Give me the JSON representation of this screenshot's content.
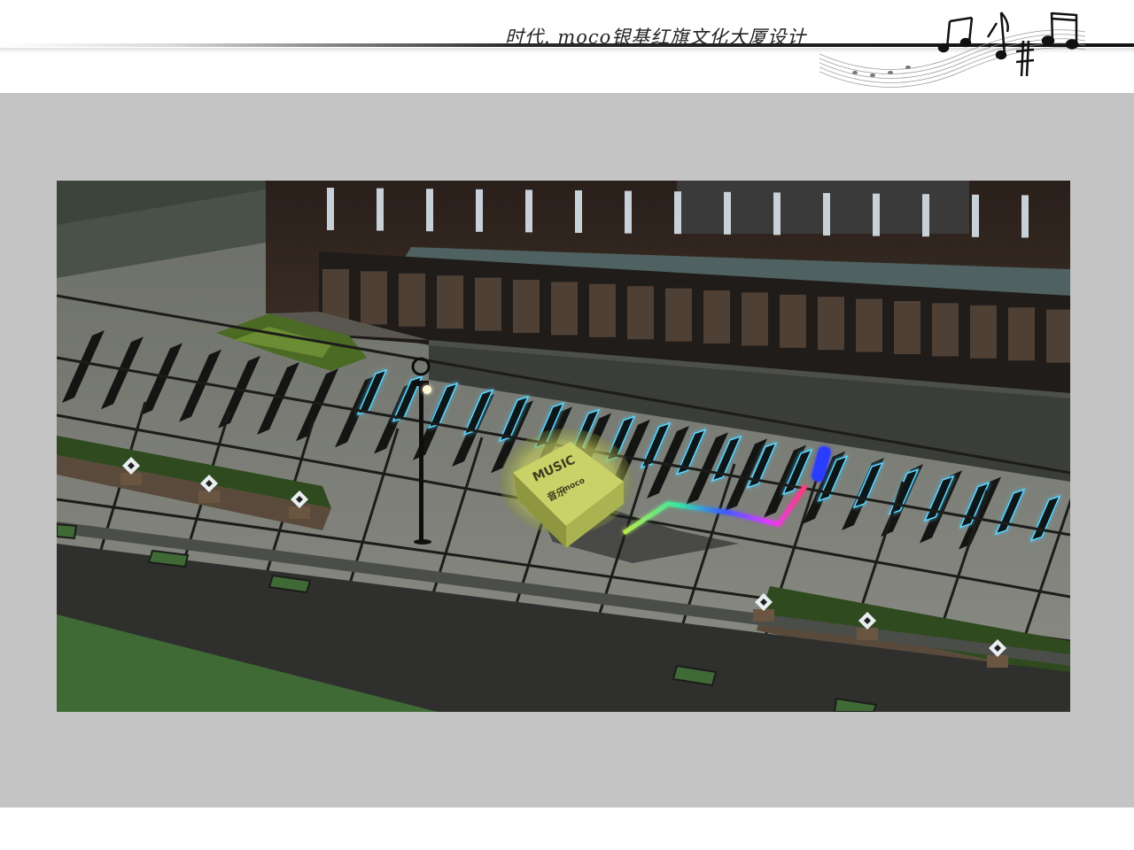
{
  "header": {
    "title": "时代. moco银基红旗文化大厦设计",
    "decoration_icon": "music-notes-icon"
  },
  "colors": {
    "page_background": "#ffffff",
    "panel_background": "#c4c4c4",
    "building_facade": "#2e241f",
    "plaza_paving": "#7d7f78",
    "key_glow": "#5fd6ff",
    "cube_glow": "#dfe87a",
    "hedge_green": "#2f4a1e"
  },
  "scene": {
    "subject": "night-rendering-piano-key-plaza",
    "icons": [
      "street-lamp-icon",
      "glowing-cube-icon",
      "uplight-icon",
      "rainbow-light-strip-icon"
    ]
  }
}
